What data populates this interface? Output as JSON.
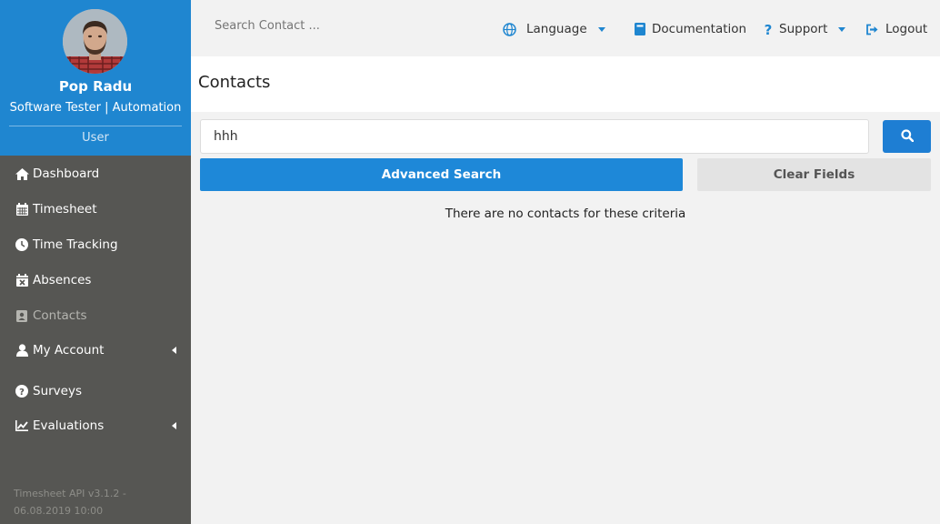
{
  "sidebar": {
    "profile": {
      "name": "Pop Radu",
      "role": "Software Tester | Automation",
      "type": "User"
    },
    "items": [
      {
        "label": "Dashboard",
        "icon": "home-icon"
      },
      {
        "label": "Timesheet",
        "icon": "calendar-icon"
      },
      {
        "label": "Time Tracking",
        "icon": "clock-icon"
      },
      {
        "label": "Absences",
        "icon": "calendar-x-icon"
      },
      {
        "label": "Contacts",
        "icon": "contact-card-icon"
      },
      {
        "label": "My Account",
        "icon": "user-icon"
      },
      {
        "label": "Surveys",
        "icon": "question-circle-icon"
      },
      {
        "label": "Evaluations",
        "icon": "line-chart-icon"
      }
    ],
    "version": "Timesheet API v3.1.2 - 06.08.2019 10:00"
  },
  "topbar": {
    "search_placeholder": "Search Contact ...",
    "language": "Language",
    "documentation": "Documentation",
    "support": "Support",
    "logout": "Logout"
  },
  "page": {
    "title": "Contacts",
    "search_value": "hhh",
    "advanced_search": "Advanced Search",
    "clear_fields": "Clear Fields",
    "empty_message": "There are no contacts for these criteria"
  },
  "colors": {
    "primary": "#1f86d0",
    "sidebar": "#565653",
    "background": "#f2f2f2"
  }
}
